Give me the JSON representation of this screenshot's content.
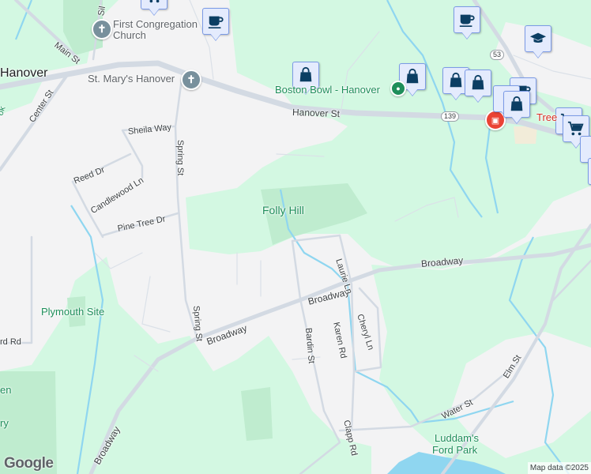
{
  "map": {
    "colors": {
      "land": "#f3f3f4",
      "park": "#d3f8e2",
      "park_dark": "#bfeccf",
      "water": "#8fd6f0",
      "road": "#d3dae3",
      "marker_bg": "#e4ebfd",
      "marker_icon": "#0b3e63",
      "poi_text": "#1e8e5a"
    },
    "places": {
      "town": "Hanover",
      "church1_line1": "First Congregation",
      "church1_line2": "Church",
      "church2": "St. Mary's Hanover",
      "folly_hill": "Folly Hill",
      "bowl": "Boston Bowl - Hanover",
      "plymouth": "Plymouth Site",
      "park_line1": "Luddam's",
      "park_line2": "Ford Park",
      "tree_store": "Tree",
      "frag_en": "en",
      "frag_ry": "ry",
      "frag_ok": "ok"
    },
    "streets": {
      "main": "Main St",
      "center": "Center St",
      "sil": "Sil",
      "hanover": "Hanover St",
      "sheila": "Sheila Way",
      "spring1": "Spring St",
      "spring2": "Spring St",
      "reed": "Reed Dr",
      "candlewood": "Candlewood Ln",
      "pine": "Pine Tree Dr",
      "broadway1": "Broadway",
      "broadway2": "Broadway",
      "broadway3": "Broadway",
      "broadway4": "Broadway",
      "laurie": "Laurie Ln",
      "cheryl": "Cheryl Ln",
      "karen": "Karen Rd",
      "bardin": "Bardin St",
      "clapp": "Clapp Rd",
      "water": "Water St",
      "elm": "Elm St",
      "rd_frag": "rd Rd"
    },
    "shields": {
      "r139": "139",
      "r53": "53"
    },
    "markers": [
      "cart-icon",
      "coffee-icon",
      "shopping-bag-icon",
      "shopping-bag-icon",
      "coffee-icon",
      "graduation-cap-icon",
      "shopping-bag-icon",
      "shopping-bag-icon",
      "coffee-icon",
      "shopping-bag-icon",
      "shopping-cart-icon",
      "shopping-cart-icon"
    ],
    "logo": "Google",
    "attribution": "Map data ©2025"
  }
}
